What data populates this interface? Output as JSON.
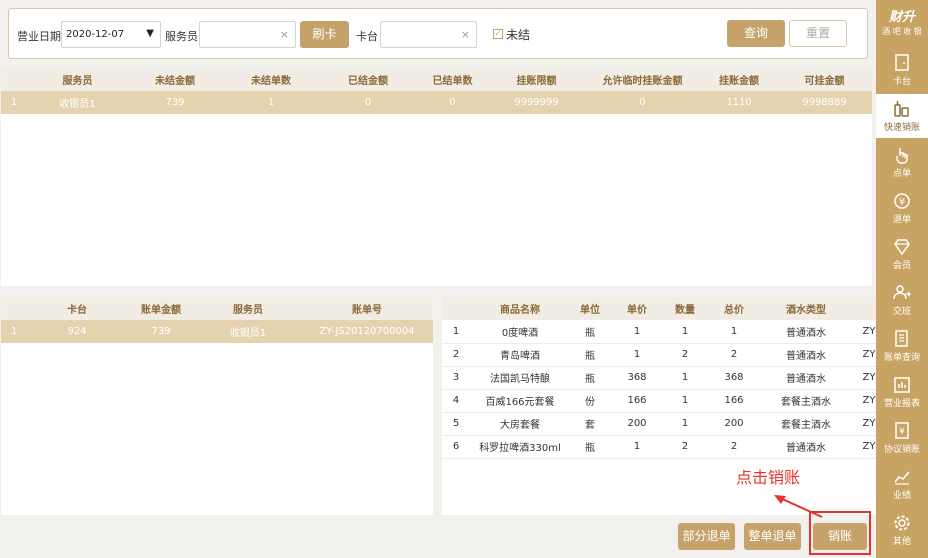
{
  "filter": {
    "date_label": "营业日期",
    "date_value": "2020-12-07",
    "waiter_label": "服务员",
    "waiter_value": "",
    "swipe_card": "刷卡",
    "card_table_label": "卡台",
    "card_table_value": "",
    "unsettled_label": "未结",
    "unsettled_checked": true,
    "query": "查询",
    "reset": "重置"
  },
  "summary": {
    "headers": [
      "",
      "服务员",
      "未结金额",
      "未结单数",
      "已结金额",
      "已结单数",
      "挂账限额",
      "允许临时挂账金额",
      "挂账金额",
      "可挂金额"
    ],
    "rows": [
      [
        "1",
        "收银员1",
        "739",
        "1",
        "0",
        "0",
        "9999999",
        "0",
        "1110",
        "9998889"
      ]
    ]
  },
  "bills": {
    "headers": [
      "",
      "卡台",
      "账单金额",
      "服务员",
      "账单号"
    ],
    "rows": [
      [
        "1",
        "924",
        "739",
        "收银员1",
        "ZY-JS20120700004"
      ]
    ]
  },
  "items": {
    "headers": [
      "",
      "商品名称",
      "单位",
      "单价",
      "数量",
      "总价",
      "酒水类型",
      ""
    ],
    "rows": [
      [
        "1",
        "0度啤酒",
        "瓶",
        "1",
        "1",
        "1",
        "普通酒水",
        "ZY"
      ],
      [
        "2",
        "青岛啤酒",
        "瓶",
        "1",
        "2",
        "2",
        "普通酒水",
        "ZY"
      ],
      [
        "3",
        "法国凯马特酿",
        "瓶",
        "368",
        "1",
        "368",
        "普通酒水",
        "ZY"
      ],
      [
        "4",
        "百威166元套餐",
        "份",
        "166",
        "1",
        "166",
        "套餐主酒水",
        "ZY"
      ],
      [
        "5",
        "大房套餐",
        "套",
        "200",
        "1",
        "200",
        "套餐主酒水",
        "ZY"
      ],
      [
        "6",
        "科罗拉啤酒330ml",
        "瓶",
        "1",
        "2",
        "2",
        "普通酒水",
        "ZY"
      ]
    ]
  },
  "actions": {
    "partial_refund": "部分退单",
    "full_refund": "整单退单",
    "settle": "销账"
  },
  "annotation": "点击销账",
  "sidebar": {
    "brand": "财升",
    "brand_sub": "酒 吧 收 银",
    "items": [
      {
        "label": "卡台",
        "icon": "door-icon"
      },
      {
        "label": "快速销账",
        "icon": "bottles-icon"
      },
      {
        "label": "点单",
        "icon": "hand-pointer-icon"
      },
      {
        "label": "退单",
        "icon": "yen-refund-icon"
      },
      {
        "label": "会员",
        "icon": "diamond-icon"
      },
      {
        "label": "交班",
        "icon": "shift-users-icon"
      },
      {
        "label": "账单查询",
        "icon": "bill-search-icon"
      },
      {
        "label": "营业报表",
        "icon": "report-icon"
      },
      {
        "label": "协议销账",
        "icon": "agreement-icon"
      },
      {
        "label": "业绩",
        "icon": "chart-icon"
      },
      {
        "label": "其他",
        "icon": "gear-icon"
      }
    ],
    "active_index": 1
  },
  "colors": {
    "accent": "#c8a464",
    "selected_row": "#e5d3b0",
    "header_text": "#8a6a3a",
    "annotation": "#e8322d"
  }
}
